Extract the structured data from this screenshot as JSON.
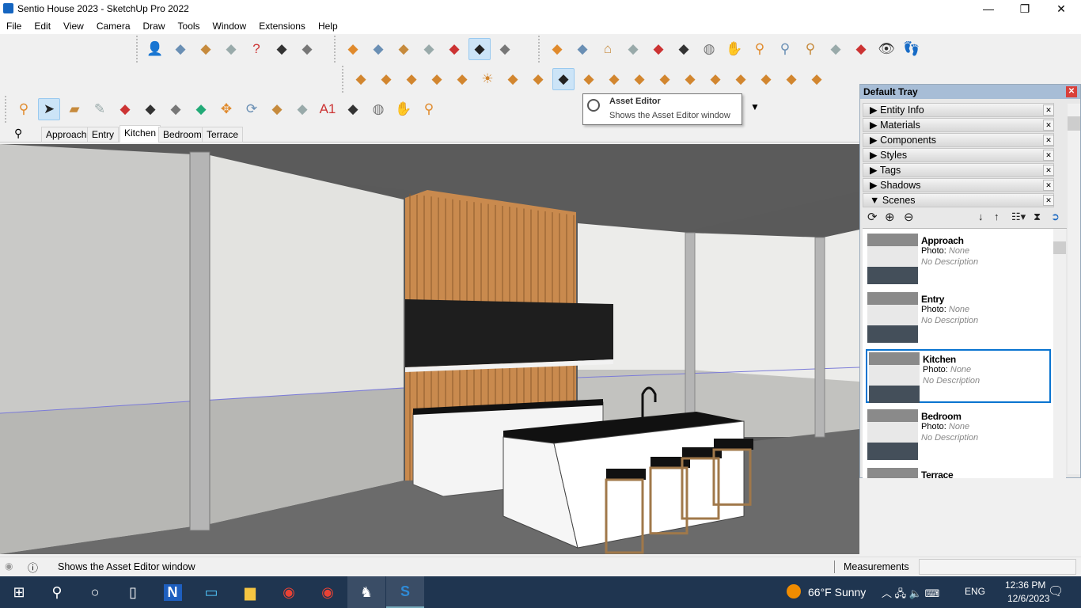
{
  "window": {
    "title": "Sentio House 2023 - SketchUp Pro 2022",
    "minimize": "—",
    "maximize": "❐",
    "close": "✕"
  },
  "menu": [
    "File",
    "Edit",
    "View",
    "Camera",
    "Draw",
    "Tools",
    "Window",
    "Extensions",
    "Help"
  ],
  "toolbars": {
    "row1a": [
      "profile-icon",
      "scan-icon",
      "upload-model-icon",
      "vr-headset-icon",
      "help-icon",
      "classifier-icon",
      "generate-report-icon"
    ],
    "row1b": [
      "xray-style-icon",
      "back-edges-icon",
      "wireframe-icon",
      "hidden-line-icon",
      "shaded-icon",
      "shaded-textures-icon",
      "monochrome-icon"
    ],
    "row1c": [
      "warehouse-icon",
      "extension-warehouse-icon",
      "home-icon",
      "iso-view-icon",
      "front-view-icon",
      "right-view-icon",
      "orbit-icon",
      "pan-icon",
      "zoom-icon",
      "zoom-window-icon",
      "zoom-extents-icon",
      "previous-view-icon",
      "position-camera-icon",
      "look-around-icon",
      "walk-icon"
    ],
    "row2": [
      "environment-icon",
      "section-plane-icon",
      "sphere-light-icon",
      "cone-icon",
      "spot-light-icon",
      "sun-icon",
      "dome-icon",
      "cube-material-icon",
      "asset-editor-icon",
      "material-palette-icon",
      "teapot-icon",
      "teapot-2-icon",
      "render-icon",
      "refresh-render-icon",
      "stove-icon",
      "stove-2-icon",
      "window-icon",
      "window-2-icon",
      "window-3-icon"
    ],
    "row3": [
      "zoom-extents-icon",
      "select-icon",
      "eraser-icon",
      "pencil-icon",
      "arc-icon",
      "rectangle-icon",
      "push-pull-icon",
      "follow-me-icon",
      "move-icon",
      "rotate-icon",
      "scale-icon",
      "tape-measure-icon",
      "text-icon",
      "paint-bucket-icon",
      "orbit-icon",
      "pan-icon",
      "zoom-icon"
    ]
  },
  "scene_tabs": [
    "Approach",
    "Entry",
    "Kitchen",
    "Bedroom",
    "Terrace"
  ],
  "active_scene_tab": "Kitchen",
  "tooltip": {
    "title": "Asset Editor",
    "description": "Shows the Asset Editor window"
  },
  "tray": {
    "title": "Default Tray",
    "panels": [
      "Entity Info",
      "Materials",
      "Components",
      "Styles",
      "Tags",
      "Shadows",
      "Scenes"
    ],
    "scenes": [
      {
        "name": "Approach",
        "photo_label": "Photo:",
        "photo": "None",
        "description": "No Description"
      },
      {
        "name": "Entry",
        "photo_label": "Photo:",
        "photo": "None",
        "description": "No Description"
      },
      {
        "name": "Kitchen",
        "photo_label": "Photo:",
        "photo": "None",
        "description": "No Description"
      },
      {
        "name": "Bedroom",
        "photo_label": "Photo:",
        "photo": "None",
        "description": "No Description"
      },
      {
        "name": "Terrace"
      }
    ],
    "selected_scene": "Kitchen"
  },
  "status": {
    "message": "Shows the Asset Editor window",
    "measurements_label": "Measurements",
    "measurements_value": ""
  },
  "taskbar": {
    "weather": "66°F  Sunny",
    "language": "ENG",
    "time": "12:36 PM",
    "date": "12/6/2023"
  },
  "colors": {
    "accent": "#0a74d0",
    "taskbar": "#1f3550",
    "wood": "#c98a4e",
    "cabinet": "#1e1e1e"
  }
}
